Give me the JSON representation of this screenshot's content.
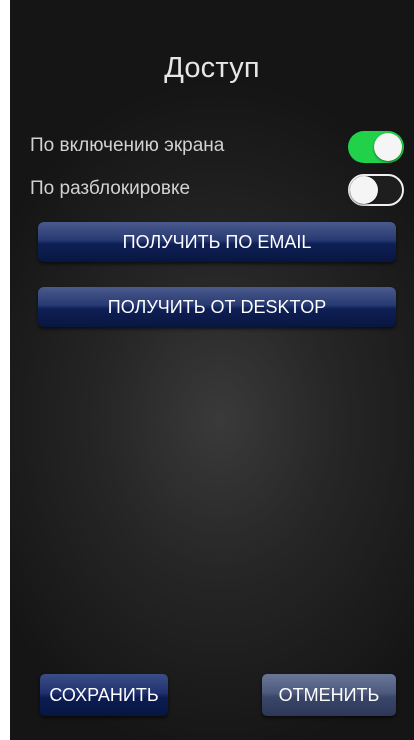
{
  "screen": {
    "title": "Доступ"
  },
  "settings": {
    "on_screen": {
      "label": "По включению экрана",
      "enabled": true
    },
    "on_unlock": {
      "label": "По разблокировке",
      "enabled": false
    }
  },
  "actions": {
    "get_by_email": "ПОЛУЧИТЬ ПО EMAIL",
    "get_from_desktop": "ПОЛУЧИТЬ ОТ DESKTOP"
  },
  "footer": {
    "save_label": "СОХРАНИТЬ",
    "cancel_label": "ОТМЕНИТЬ"
  },
  "colors": {
    "toggle_on": "#21d14a",
    "button_blue": "#1f3170"
  }
}
